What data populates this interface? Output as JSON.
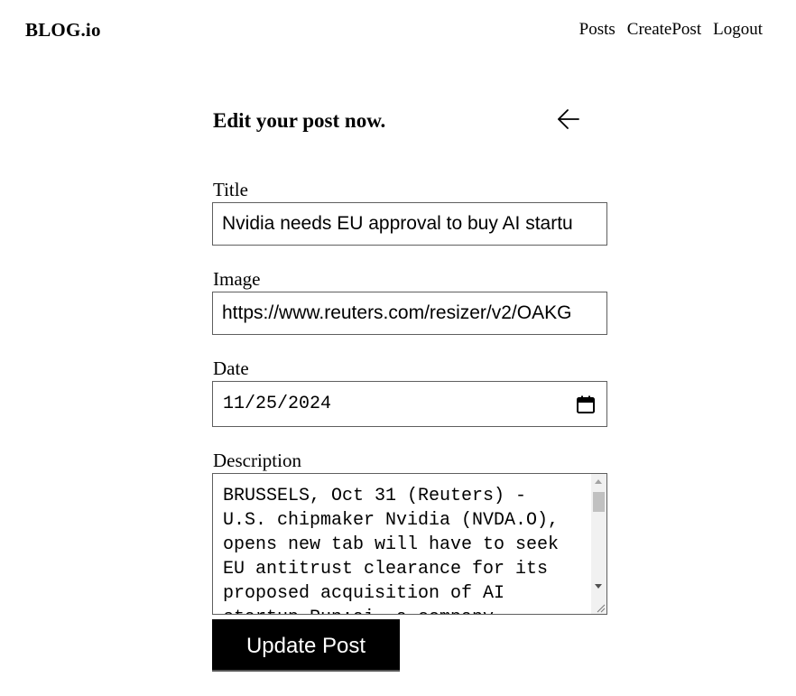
{
  "header": {
    "brand": "BLOG.io",
    "nav": [
      {
        "label": "Posts"
      },
      {
        "label": "CreatePost"
      },
      {
        "label": "Logout"
      }
    ]
  },
  "form": {
    "heading": "Edit your post now.",
    "back_icon": "arrow-left-icon",
    "title": {
      "label": "Title",
      "value": "Nvidia needs EU approval to buy AI startu"
    },
    "image": {
      "label": "Image",
      "value": "https://www.reuters.com/resizer/v2/OAKG"
    },
    "date": {
      "label": "Date",
      "value": "11/25/2024",
      "icon": "calendar-icon"
    },
    "description": {
      "label": "Description",
      "value": "BRUSSELS, Oct 31 (Reuters) - U.S. chipmaker Nvidia (NVDA.O), opens new tab will have to seek EU antitrust clearance for its proposed acquisition of AI startup Run:ai, a company"
    },
    "submit_label": "Update Post"
  }
}
